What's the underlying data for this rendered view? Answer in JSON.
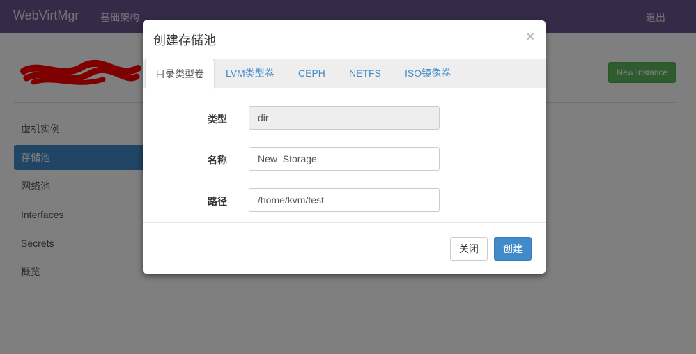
{
  "navbar": {
    "brand": "WebVirtMgr",
    "nav_link": "基础架构",
    "logout": "退出"
  },
  "header": {
    "new_instance": "New Instance"
  },
  "sidebar": {
    "items": [
      {
        "label": "虚机实例"
      },
      {
        "label": "存储池"
      },
      {
        "label": "网络池"
      },
      {
        "label": "Interfaces"
      },
      {
        "label": "Secrets"
      },
      {
        "label": "概览"
      }
    ]
  },
  "modal": {
    "title": "创建存储池",
    "close_symbol": "×",
    "tabs": [
      {
        "label": "目录类型卷"
      },
      {
        "label": "LVM类型卷"
      },
      {
        "label": "CEPH"
      },
      {
        "label": "NETFS"
      },
      {
        "label": "ISO镜像卷"
      }
    ],
    "fields": [
      {
        "label": "类型",
        "value": "dir"
      },
      {
        "label": "名称",
        "value": "New_Storage"
      },
      {
        "label": "路径",
        "value": "/home/kvm/test"
      }
    ],
    "close_button": "关闭",
    "create_button": "创建"
  },
  "colors": {
    "navbar": "#6a5693",
    "primary": "#428bca",
    "success": "#5cb85c"
  }
}
